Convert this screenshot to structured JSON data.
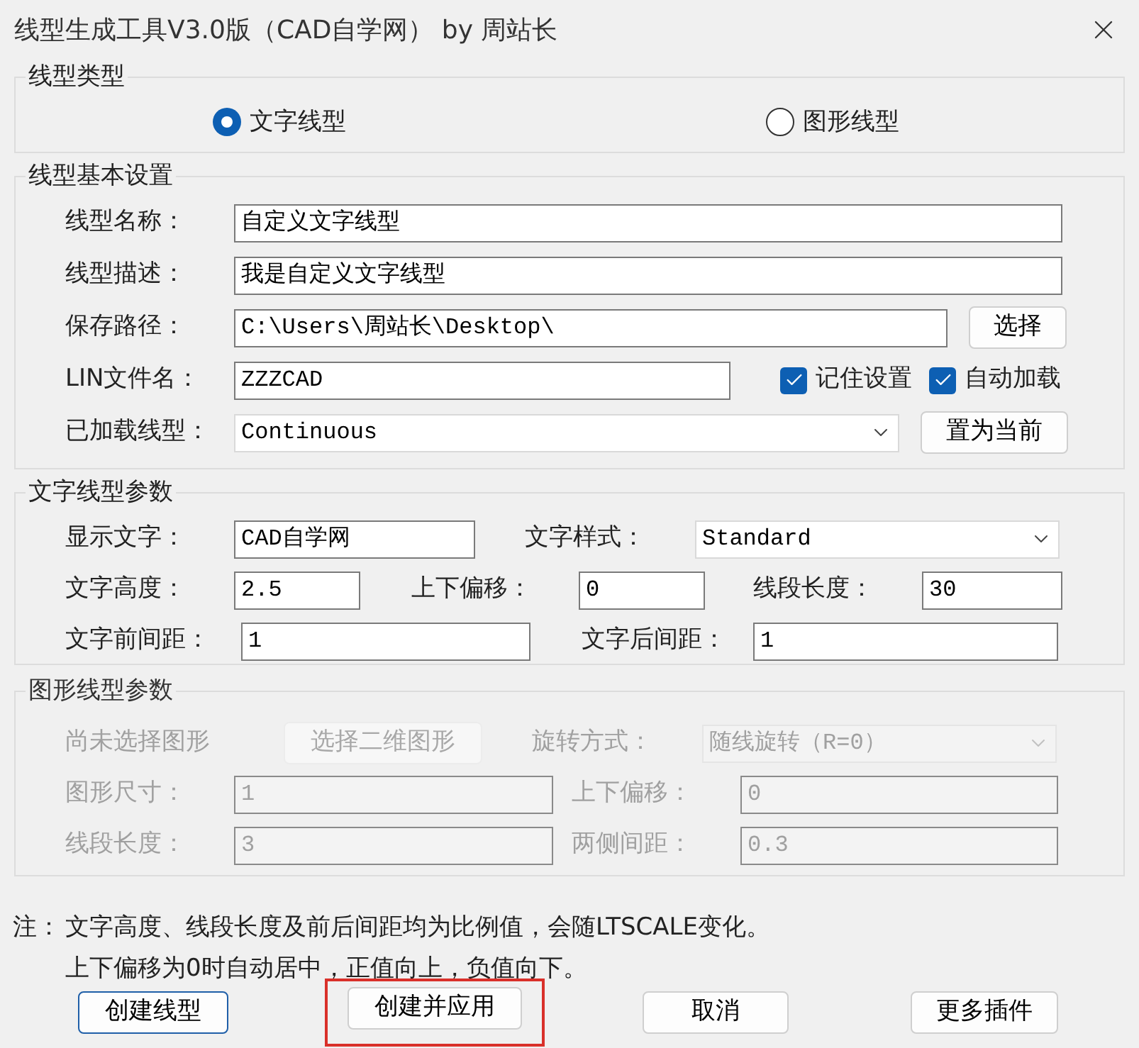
{
  "window": {
    "title": "线型生成工具V3.0版（CAD自学网） by 周站长"
  },
  "linetype_type": {
    "title": "线型类型",
    "options": [
      {
        "label": "文字线型",
        "selected": true
      },
      {
        "label": "图形线型",
        "selected": false
      }
    ]
  },
  "basic_settings": {
    "title": "线型基本设置",
    "name": {
      "label": "线型名称：",
      "value": "自定义文字线型"
    },
    "description": {
      "label": "线型描述：",
      "value": "我是自定义文字线型"
    },
    "save_path": {
      "label": "保存路径：",
      "value": "C:\\Users\\周站长\\Desktop\\",
      "button": "选择"
    },
    "lin_file": {
      "label": "LIN文件名：",
      "value": "ZZZCAD"
    },
    "checkboxes": [
      {
        "label": "记住设置",
        "checked": true
      },
      {
        "label": "自动加载",
        "checked": true
      }
    ],
    "loaded_linetype": {
      "label": "已加载线型：",
      "value": "Continuous",
      "button": "置为当前"
    }
  },
  "text_params": {
    "title": "文字线型参数",
    "disabled": false,
    "items": [
      {
        "kind": "label",
        "text": "显示文字："
      },
      {
        "kind": "field",
        "text": "CAD自学网"
      },
      {
        "kind": "label",
        "text": "文字样式："
      },
      {
        "kind": "dropdown",
        "text": "Standard"
      },
      {
        "kind": "label",
        "text": "文字高度："
      },
      {
        "kind": "field",
        "text": "2.5"
      },
      {
        "kind": "label",
        "text": "上下偏移："
      },
      {
        "kind": "field",
        "text": "0"
      },
      {
        "kind": "label",
        "text": "线段长度："
      },
      {
        "kind": "field",
        "text": "30"
      },
      {
        "kind": "label",
        "text": "文字前间距："
      },
      {
        "kind": "field",
        "text": "1"
      },
      {
        "kind": "label",
        "text": "文字后间距："
      },
      {
        "kind": "field",
        "text": "1"
      }
    ]
  },
  "shape_params": {
    "title": "图形线型参数",
    "disabled": true,
    "items": [
      {
        "kind": "label",
        "text": "尚未选择图形"
      },
      {
        "kind": "button",
        "text": "选择二维图形"
      },
      {
        "kind": "label",
        "text": "旋转方式："
      },
      {
        "kind": "dropdown",
        "text": "随线旋转（R=0）"
      },
      {
        "kind": "label",
        "text": "图形尺寸："
      },
      {
        "kind": "field",
        "text": "1"
      },
      {
        "kind": "label",
        "text": "上下偏移："
      },
      {
        "kind": "field",
        "text": "0"
      },
      {
        "kind": "label",
        "text": "线段长度："
      },
      {
        "kind": "field",
        "text": "3"
      },
      {
        "kind": "label",
        "text": "两侧间距："
      },
      {
        "kind": "field",
        "text": "0.3"
      }
    ]
  },
  "notes": [
    "注：",
    "文字高度、线段长度及前后间距均为比例值，会随LTSCALE变化。",
    "上下偏移为0时自动居中，正值向上，负值向下。"
  ],
  "buttons": [
    {
      "label": "创建线型",
      "focused": true,
      "highlighted": false
    },
    {
      "label": "创建并应用",
      "focused": false,
      "highlighted": true
    },
    {
      "label": "取消",
      "focused": false,
      "highlighted": false
    },
    {
      "label": "更多插件",
      "focused": false,
      "highlighted": false
    }
  ]
}
